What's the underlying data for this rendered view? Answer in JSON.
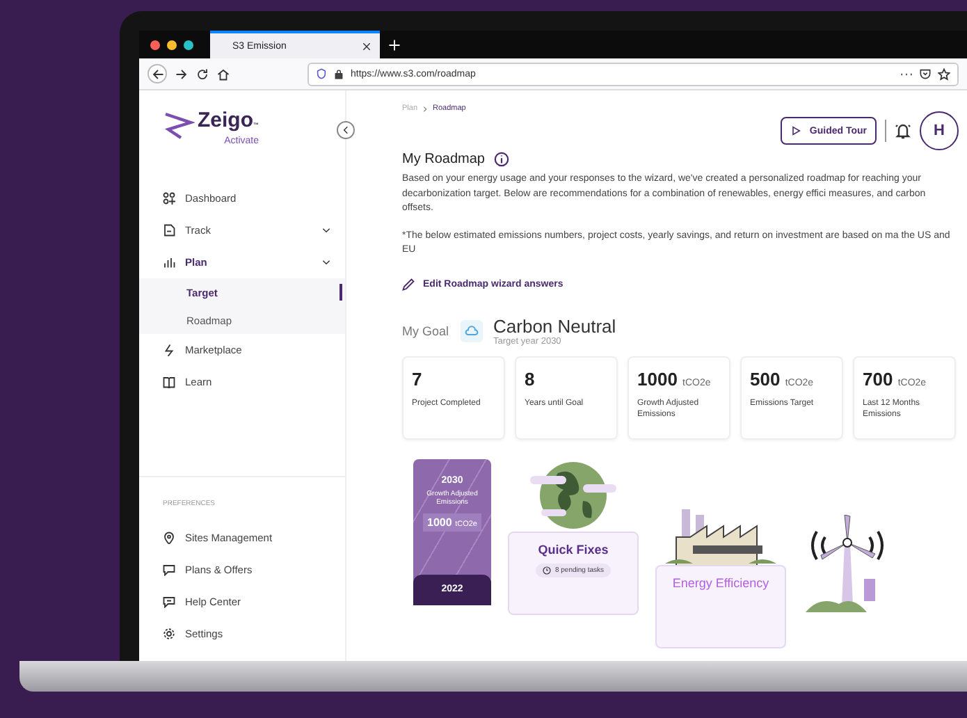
{
  "browser": {
    "tab_title": "S3 Emission",
    "url": "https://www.s3.com/roadmap"
  },
  "sidebar": {
    "logo": {
      "name": "Zeigo",
      "tm": "™",
      "sub": "Activate"
    },
    "items": [
      {
        "label": "Dashboard",
        "kind": "link",
        "selected": false
      },
      {
        "label": "Track",
        "kind": "group",
        "selected": false
      },
      {
        "label": "Plan",
        "kind": "group",
        "selected": true,
        "children": [
          {
            "label": "Target",
            "selected": true
          },
          {
            "label": "Roadmap",
            "selected": false
          }
        ]
      },
      {
        "label": "Marketplace",
        "kind": "link",
        "selected": false
      },
      {
        "label": "Learn",
        "kind": "link",
        "selected": false
      }
    ],
    "preferences_heading": "PREFERENCES",
    "preferences": [
      {
        "label": "Sites Management"
      },
      {
        "label": "Plans & Offers"
      },
      {
        "label": "Help Center"
      },
      {
        "label": "Settings"
      }
    ]
  },
  "header": {
    "breadcrumb": [
      "Plan",
      "Roadmap"
    ],
    "tour_button": "Guided Tour",
    "avatar": "H"
  },
  "roadmap": {
    "title": "My Roadmap",
    "paragraphs": [
      "Based on your energy usage and your responses to the wizard, we've created a personalized roadmap for reaching your decarbonization target. Below are recommendations for a combination of renewables, energy effici measures, and carbon offsets.",
      "*The below estimated emissions numbers, project costs, yearly savings, and return on investment are based on ma the US and EU"
    ],
    "edit_link": "Edit Roadmap wizard answers"
  },
  "goal": {
    "label": "My Goal",
    "title": "Carbon Neutral",
    "subtitle": "Target year 2030"
  },
  "stats": [
    {
      "value": "7",
      "label": "Project Completed"
    },
    {
      "value": "8",
      "label": "Years until Goal"
    },
    {
      "value": "1000",
      "unit": "tCO2e",
      "label": "Growth Adjusted Emissions"
    },
    {
      "value": "500",
      "unit": "tCO2e",
      "label": "Emissions Target"
    },
    {
      "value": "700",
      "unit": "tCO2e",
      "label": "Last 12 Months Emissions"
    }
  ],
  "timeline": {
    "year": "2030",
    "caption": "Growth Adjusted Emissions",
    "value": "1000",
    "unit": "tCO2e",
    "start_year": "2022"
  },
  "steps": [
    {
      "title": "Quick Fixes",
      "chip": "8 pending tasks"
    },
    {
      "title": "Energy Efficiency"
    }
  ]
}
